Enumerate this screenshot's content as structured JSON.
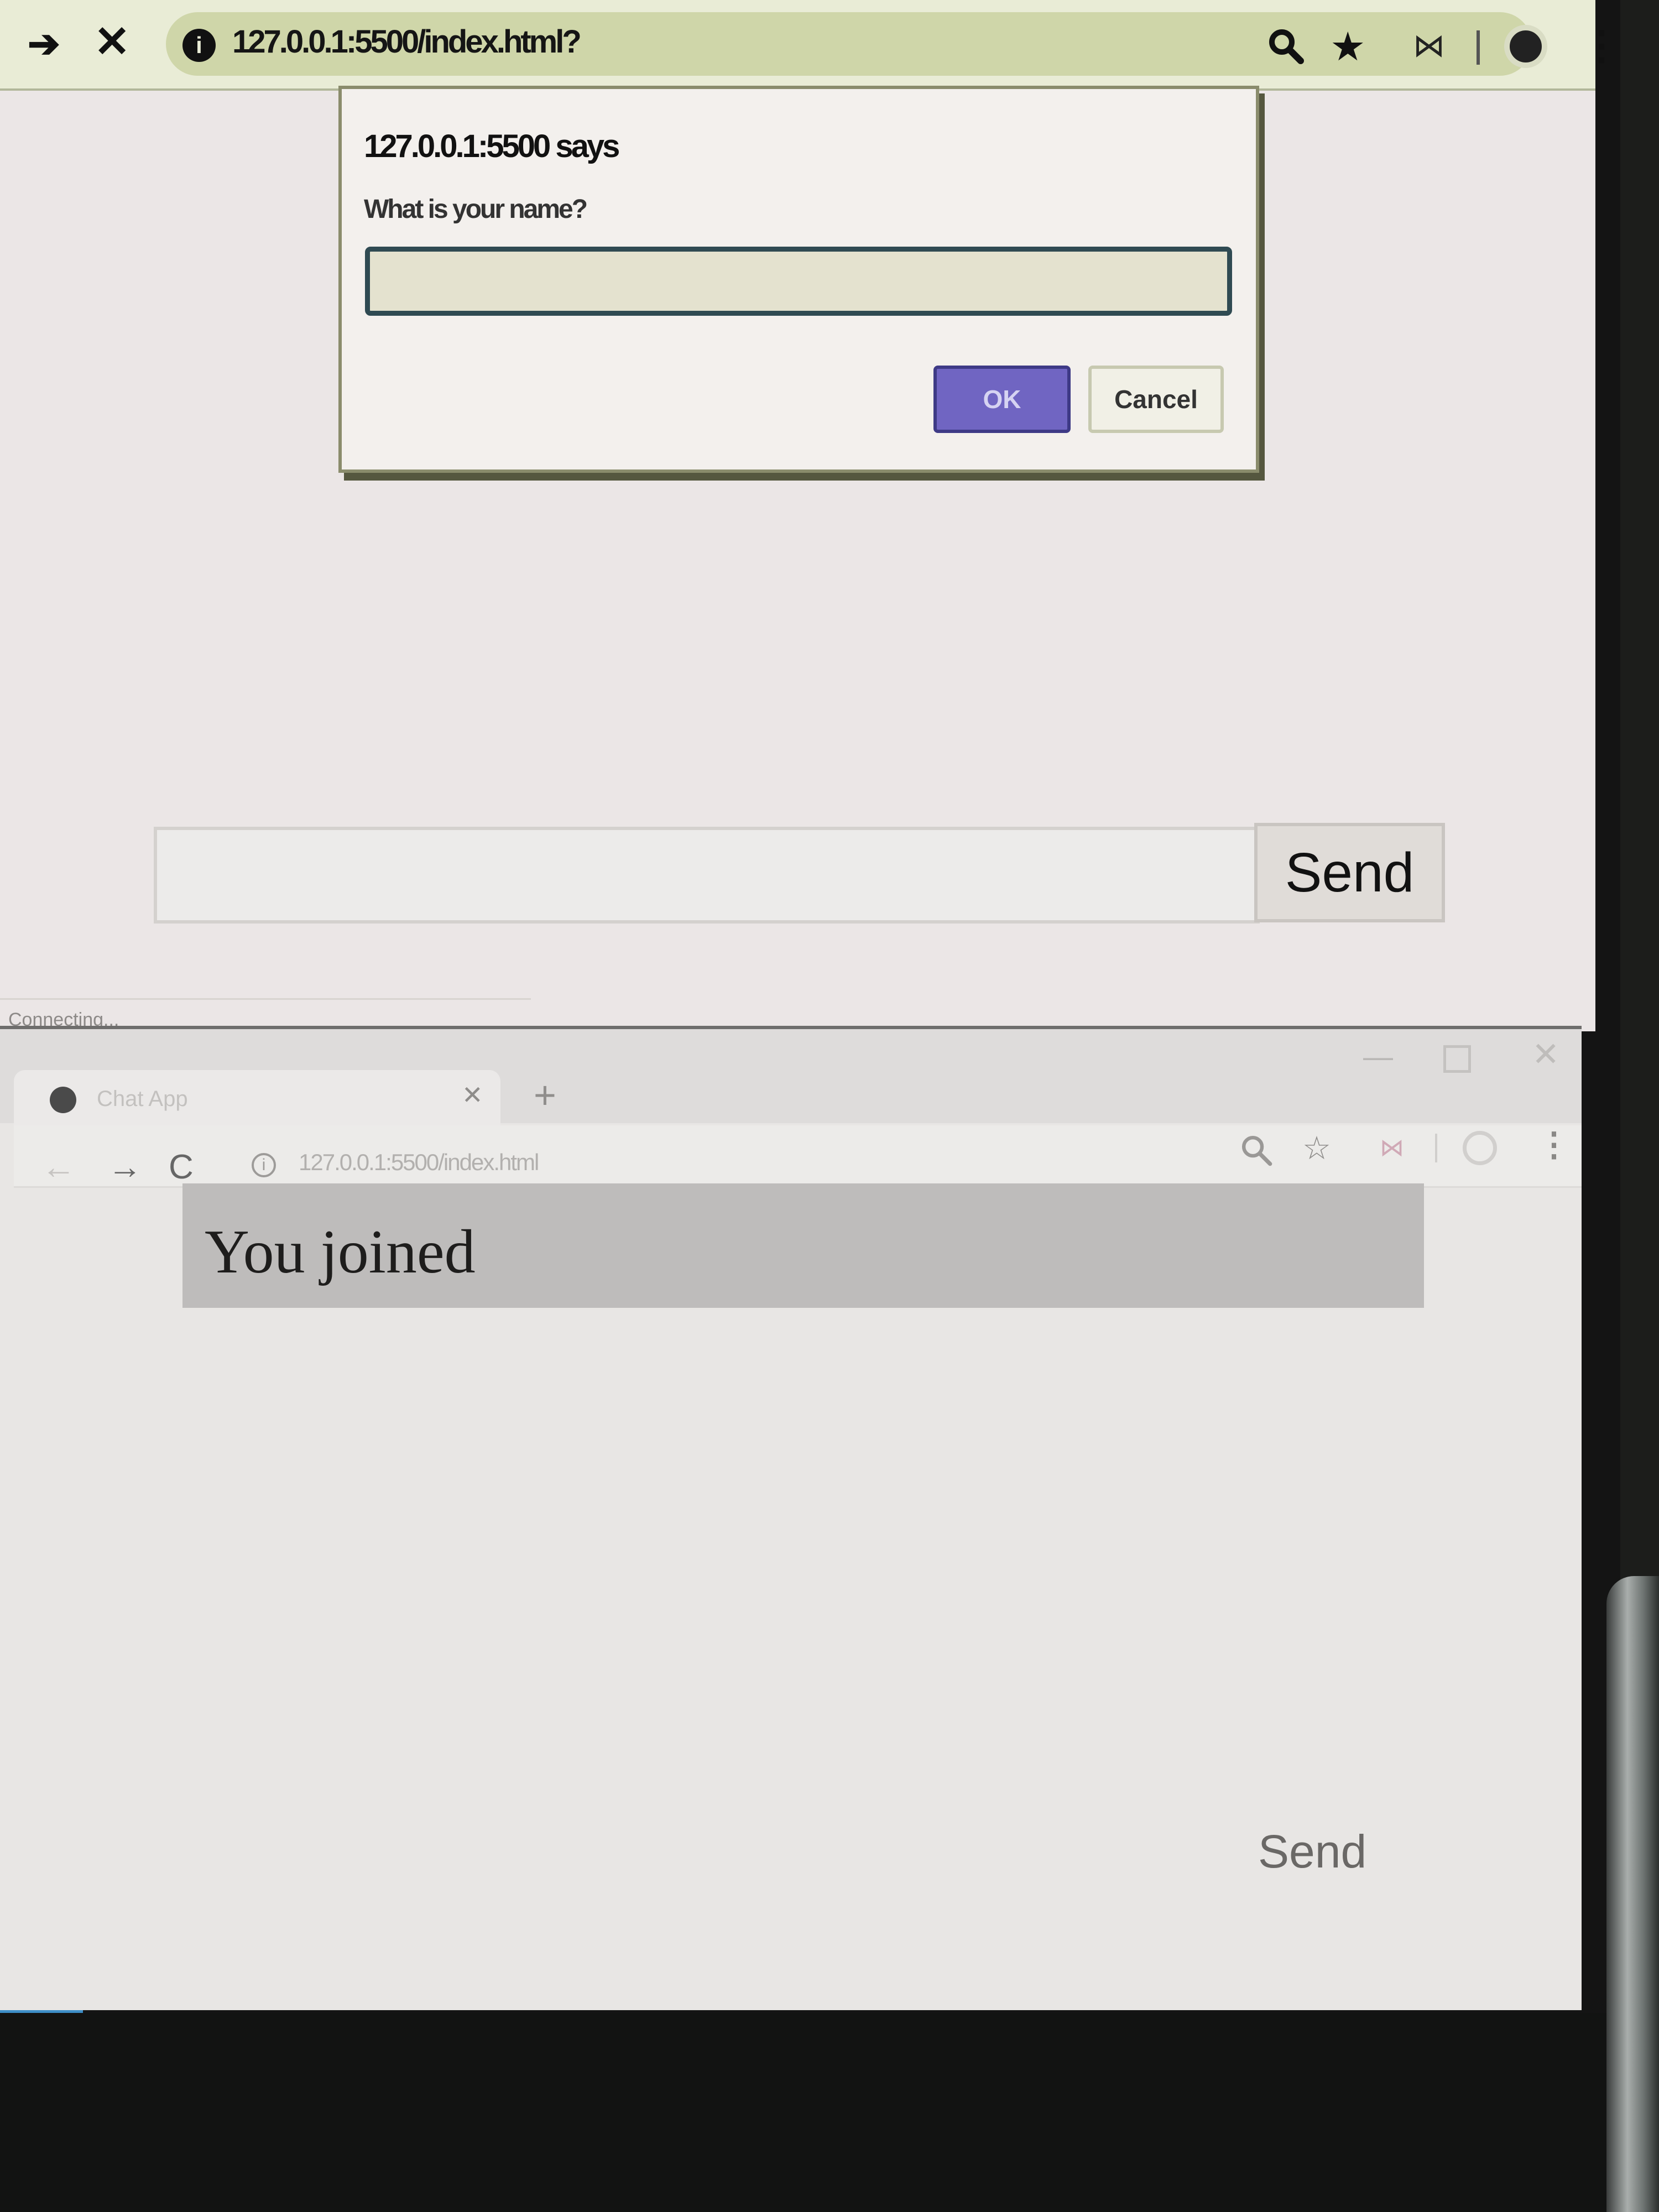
{
  "top_window": {
    "url": "127.0.0.1:5500/index.html?",
    "dialog": {
      "title": "127.0.0.1:5500 says",
      "message": "What is your name?",
      "input_value": "",
      "ok_label": "OK",
      "cancel_label": "Cancel"
    },
    "send_label": "Send",
    "status_text": "Connecting..."
  },
  "bottom_window": {
    "tab_title": "Chat App",
    "url": "127.0.0.1:5500/index.html",
    "messages": [
      "You joined"
    ],
    "send_label": "Send"
  },
  "icons": {
    "back": "arrow-left-icon",
    "forward": "arrow-right-icon",
    "stop": "close-icon",
    "reload": "reload-icon",
    "info": "info-icon",
    "zoom": "zoom-icon",
    "star": "star-icon",
    "menu": "kebab-menu-icon"
  },
  "colors": {
    "ok_button": "#7065c2",
    "message_bg": "#bebcbb"
  }
}
